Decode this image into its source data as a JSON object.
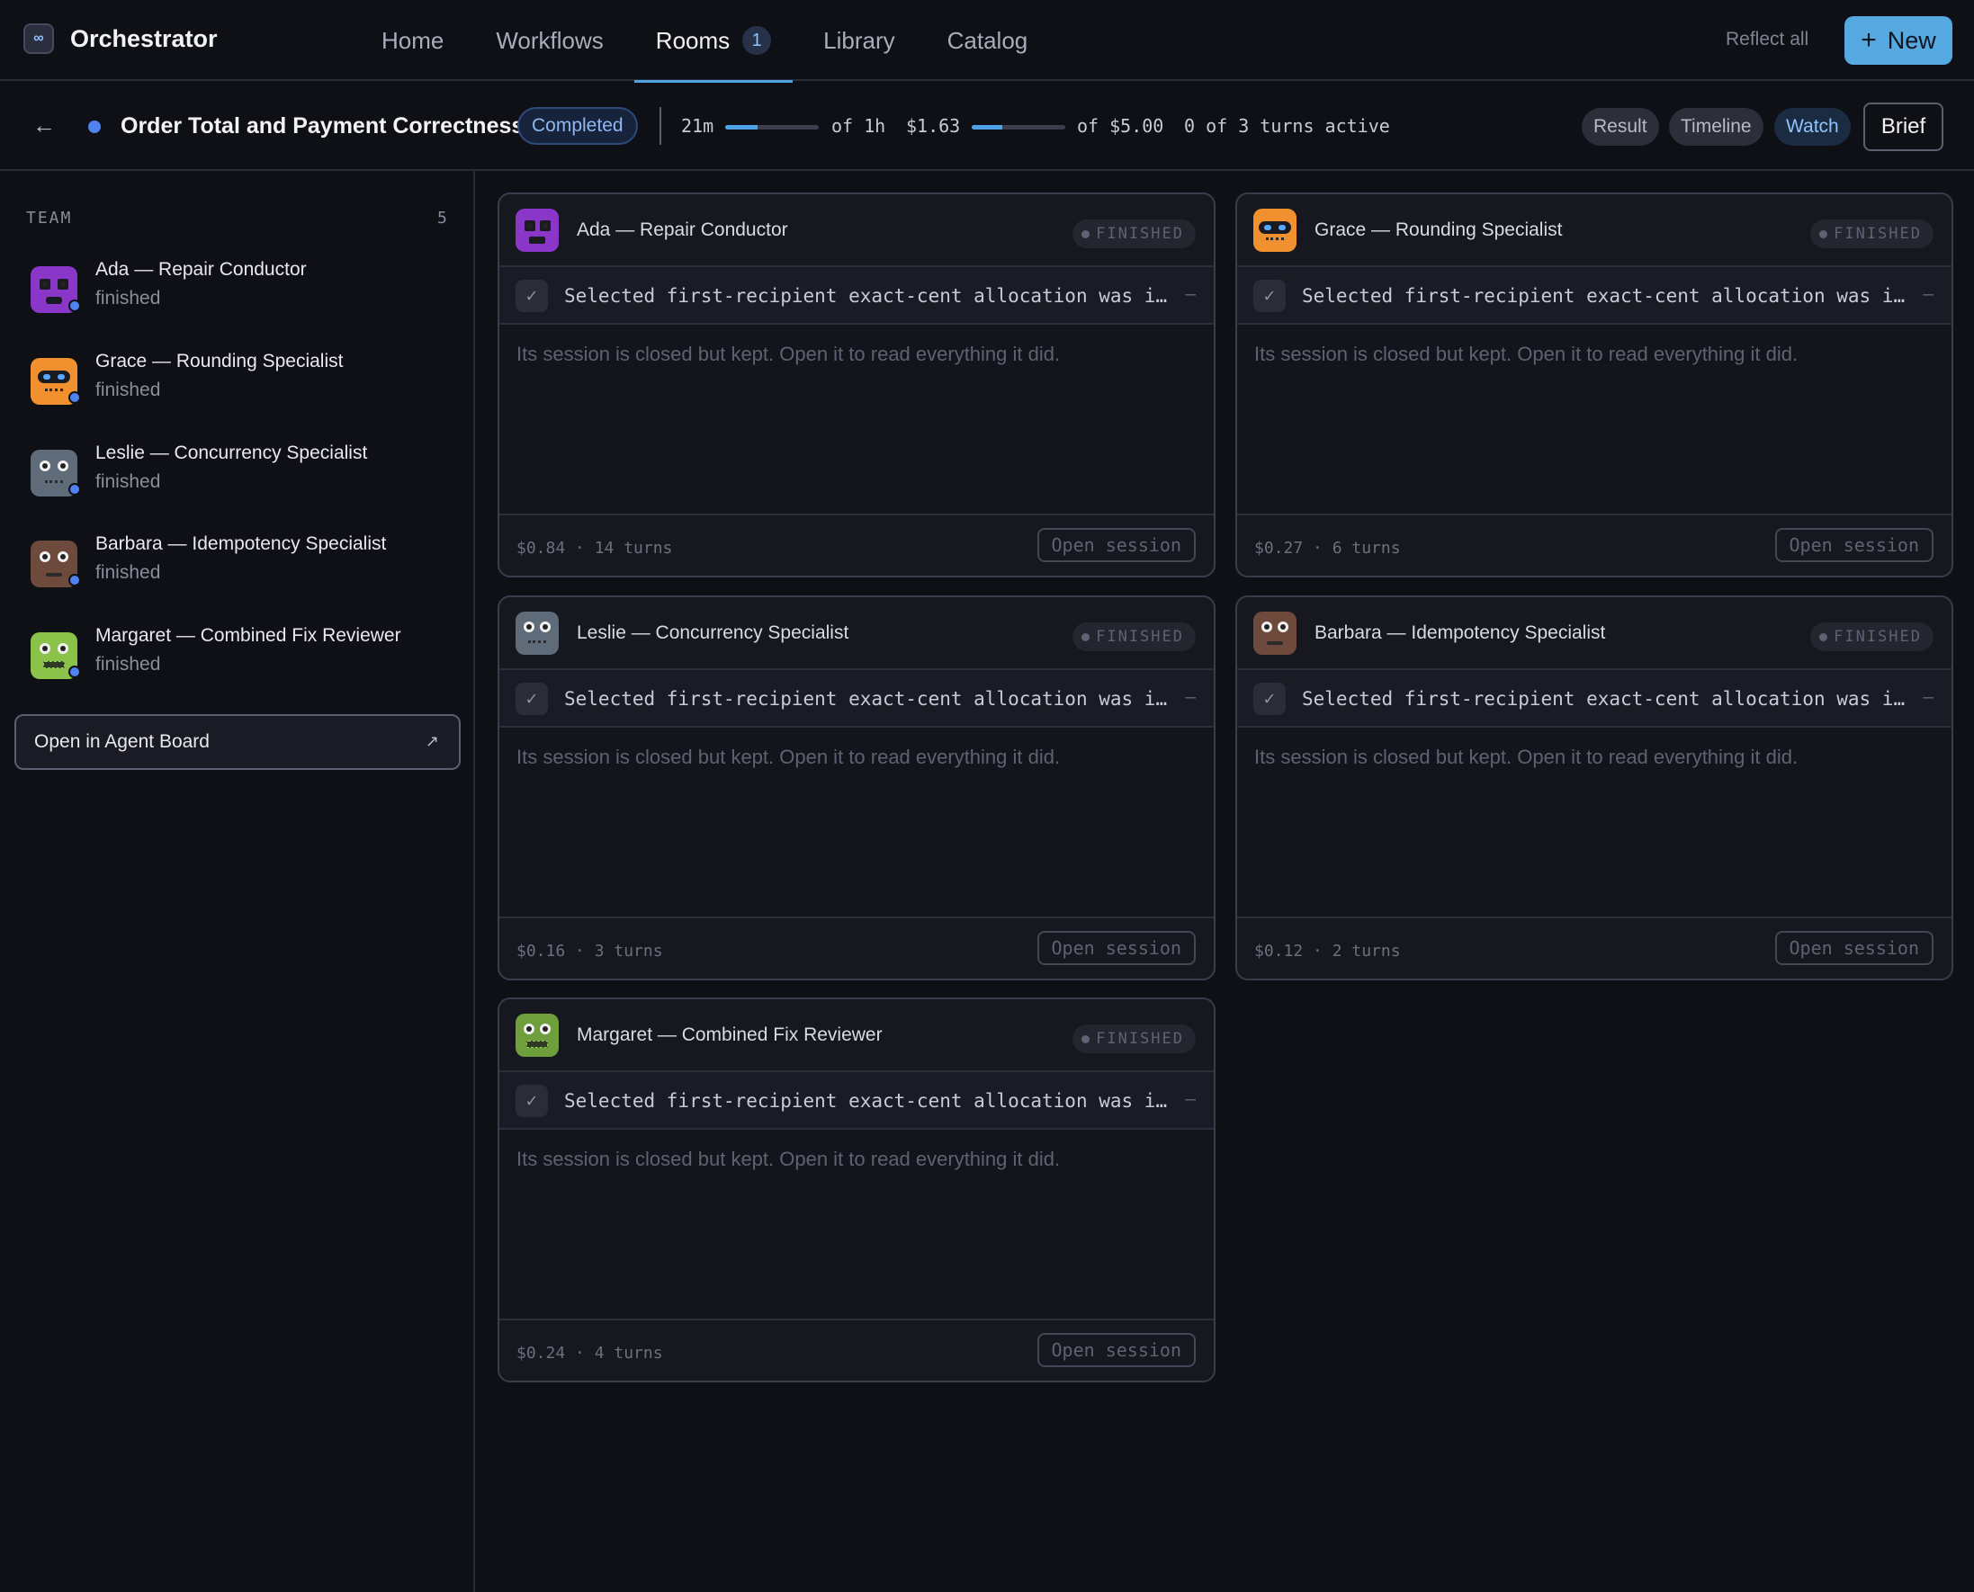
{
  "app": {
    "name": "Orchestrator"
  },
  "nav": {
    "items": [
      {
        "label": "Home"
      },
      {
        "label": "Workflows"
      },
      {
        "label": "Rooms",
        "badge": "1",
        "active": true
      },
      {
        "label": "Library"
      },
      {
        "label": "Catalog"
      }
    ],
    "reflect_all": "Reflect all",
    "new_plus": "+",
    "new_label": "New"
  },
  "room": {
    "back_arrow": "←",
    "title": "Order Total and Payment Correctness",
    "status": "Completed",
    "time_used": "21m",
    "time_limit": "of 1h",
    "time_progress": 0.35,
    "cost_used": "$1.63",
    "cost_limit": "of $5.00",
    "cost_progress": 0.326,
    "turns_active": "0 of 3 turns active",
    "buttons": {
      "result": "Result",
      "timeline": "Timeline",
      "watch": "Watch",
      "brief": "Brief"
    }
  },
  "sidebar": {
    "team_label": "TEAM",
    "team_count": "5",
    "members": [
      {
        "name": "Ada — Repair Conductor",
        "status": "finished"
      },
      {
        "name": "Grace — Rounding Specialist",
        "status": "finished"
      },
      {
        "name": "Leslie — Concurrency Specialist",
        "status": "finished"
      },
      {
        "name": "Barbara — Idempotency Specialist",
        "status": "finished"
      },
      {
        "name": "Margaret — Combined Fix Reviewer",
        "status": "finished"
      }
    ],
    "agent_board_label": "Open in Agent Board",
    "agent_board_icon": "↗"
  },
  "cards": [
    {
      "name": "Ada — Repair Conductor",
      "status": "FINISHED",
      "check": "✓",
      "task": "Selected first-recipient exact-cent allocation was implemented",
      "dash": "–",
      "note": "Its session is closed but kept. Open it to read everything it did.",
      "meta": "$0.84 · 14 turns",
      "open": "Open session"
    },
    {
      "name": "Grace — Rounding Specialist",
      "status": "FINISHED",
      "check": "✓",
      "task": "Selected first-recipient exact-cent allocation was implemented",
      "dash": "–",
      "note": "Its session is closed but kept. Open it to read everything it did.",
      "meta": "$0.27 · 6 turns",
      "open": "Open session"
    },
    {
      "name": "Leslie — Concurrency Specialist",
      "status": "FINISHED",
      "check": "✓",
      "task": "Selected first-recipient exact-cent allocation was implemented",
      "dash": "–",
      "note": "Its session is closed but kept. Open it to read everything it did.",
      "meta": "$0.16 · 3 turns",
      "open": "Open session"
    },
    {
      "name": "Barbara — Idempotency Specialist",
      "status": "FINISHED",
      "check": "✓",
      "task": "Selected first-recipient exact-cent allocation was implemented",
      "dash": "–",
      "note": "Its session is closed but kept. Open it to read everything it did.",
      "meta": "$0.12 · 2 turns",
      "open": "Open session"
    },
    {
      "name": "Margaret — Combined Fix Reviewer",
      "status": "FINISHED",
      "check": "✓",
      "task": "Selected first-recipient exact-cent allocation was implemented",
      "dash": "–",
      "note": "Its session is closed but kept. Open it to read everything it did.",
      "meta": "$0.24 · 4 turns",
      "open": "Open session"
    }
  ],
  "avatar_colors": {
    "ada": "#8a36c8",
    "grace": "#f0902e",
    "leslie": "#5f6b78",
    "barbara": "#6e4a3c",
    "margaret": "#8bc34a"
  },
  "accent_color": "#56a8e0"
}
